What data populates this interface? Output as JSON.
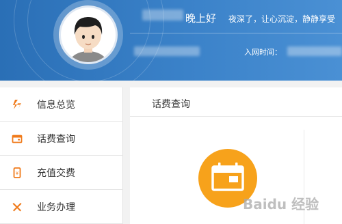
{
  "header": {
    "greeting": "晚上好",
    "motto": "夜深了，让心沉淀，静静享受",
    "join_time_label": "入网时间："
  },
  "sidebar": {
    "items": [
      {
        "label": "信息总览",
        "icon": "info-overview-icon"
      },
      {
        "label": "话费查询",
        "icon": "wallet-icon"
      },
      {
        "label": "充值交费",
        "icon": "phone-recharge-icon"
      },
      {
        "label": "业务办理",
        "icon": "tools-icon"
      }
    ]
  },
  "main": {
    "title": "话费查询",
    "feature_icon": "calendar-bill-icon"
  },
  "colors": {
    "header_blue": "#2f75bd",
    "accent_orange": "#f7a21b",
    "icon_orange": "#f07a1a"
  },
  "watermark": "Baidu 经验"
}
